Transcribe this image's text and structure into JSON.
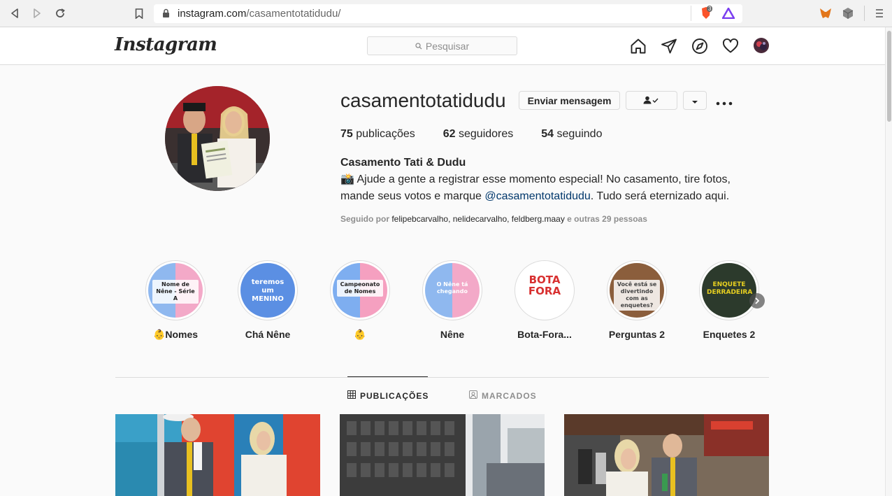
{
  "browser": {
    "url_host": "instagram.com",
    "url_path": "/casamentotatidudu/",
    "brave_shield_count": "3"
  },
  "header": {
    "logo": "Instagram",
    "search_placeholder": "Pesquisar"
  },
  "profile": {
    "username": "casamentotatidudu",
    "message_button": "Enviar mensagem",
    "stats": {
      "posts_count": "75",
      "posts_label": "publicações",
      "followers_count": "62",
      "followers_label": "seguidores",
      "following_count": "54",
      "following_label": "seguindo"
    },
    "full_name": "Casamento Tati & Dudu",
    "bio_line1": "📸 Ajude a gente a registrar esse momento especial! No casamento, tire fotos,",
    "bio_line2_pre": "mande seus votos e marque ",
    "bio_mention": "@casamentotatidudu",
    "bio_line2_post": ". Tudo será eternizado aqui.",
    "followed_prefix": "Seguido por ",
    "followed_names": "felipebcarvalho, nelidecarvalho, feldberg.maay",
    "followed_suffix": " e outras 29 pessoas"
  },
  "highlights": [
    {
      "label": "👶Nomes",
      "text": "Nome de Nêne - Série A",
      "colors": [
        "#8fb8ef",
        "#f3a9c8"
      ]
    },
    {
      "label": "Chá Nêne",
      "text": "teremos um MENINO",
      "colors": [
        "#5b8fe3",
        "#5b8fe3"
      ]
    },
    {
      "label": "👶",
      "text": "Campeonato de Nomes",
      "colors": [
        "#7eaef0",
        "#f5a0c0"
      ]
    },
    {
      "label": "Nêne",
      "text": "O Nêne tá chegando",
      "colors": [
        "#8fb8ef",
        "#f3a9c8"
      ]
    },
    {
      "label": "Bota-Fora...",
      "text": "BOTA FORA",
      "colors": [
        "#ffffff",
        "#ffffff"
      ]
    },
    {
      "label": "Perguntas 2",
      "text": "Você está se divertindo com as enquetes?",
      "colors": [
        "#8b5e3c",
        "#8b5e3c"
      ]
    },
    {
      "label": "Enquetes 2",
      "text": "ENQUETE DERRADEIRA",
      "colors": [
        "#2c3a2c",
        "#2c3a2c"
      ]
    }
  ],
  "tabs": {
    "posts": "PUBLICAÇÕES",
    "tagged": "MARCADOS"
  },
  "colors": {
    "accent": "#0095f6",
    "text": "#262626",
    "muted": "#8e8e8e",
    "border": "#dbdbdb"
  }
}
